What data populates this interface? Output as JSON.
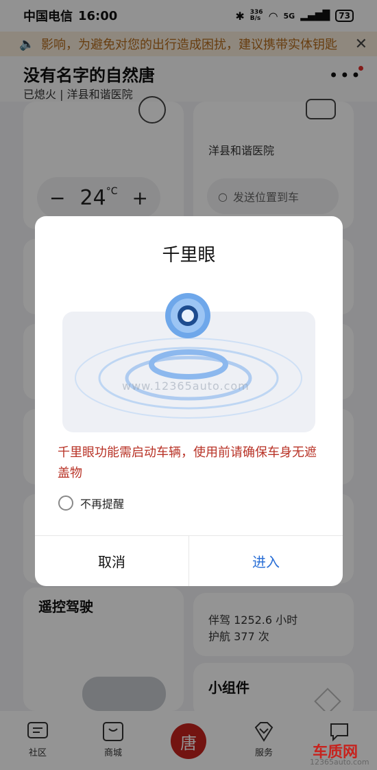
{
  "status_bar": {
    "carrier": "中国电信",
    "time": "16:00",
    "net_speed_value": "336",
    "net_speed_unit": "B/s",
    "signal_label": "5G",
    "battery": "73"
  },
  "notice": {
    "text": "影响，为避免对您的出行造成困扰，建议携带实体钥匙"
  },
  "header": {
    "title": "没有名字的自然唐",
    "status": "已熄火 | 洋县和谐医院"
  },
  "climate_card": {
    "temperature": "24",
    "unit": "°C",
    "minus": "−",
    "plus": "+"
  },
  "location_card": {
    "location": "洋县和谐医院",
    "send_placeholder": "发送位置到车"
  },
  "remote_drive": {
    "label": "遥控驾驶"
  },
  "stats_card": {
    "companion": "伴驾 1252.6 小时",
    "navigation": "护航 377 次"
  },
  "widgets": {
    "label": "小组件"
  },
  "bottom_nav": {
    "items": [
      {
        "label": "社区"
      },
      {
        "label": "商城"
      },
      {
        "label": "唐"
      },
      {
        "label": "服务"
      },
      {
        "label": ""
      }
    ]
  },
  "dialog": {
    "title": "千里眼",
    "warning": "千里眼功能需启动车辆，使用前请确保车身无遮盖物",
    "no_remind": "不再提醒",
    "cancel": "取消",
    "enter": "进入"
  },
  "watermark": {
    "text": "www.12365auto.com",
    "logo": "车质网",
    "logo_sub": "12365auto.com"
  }
}
